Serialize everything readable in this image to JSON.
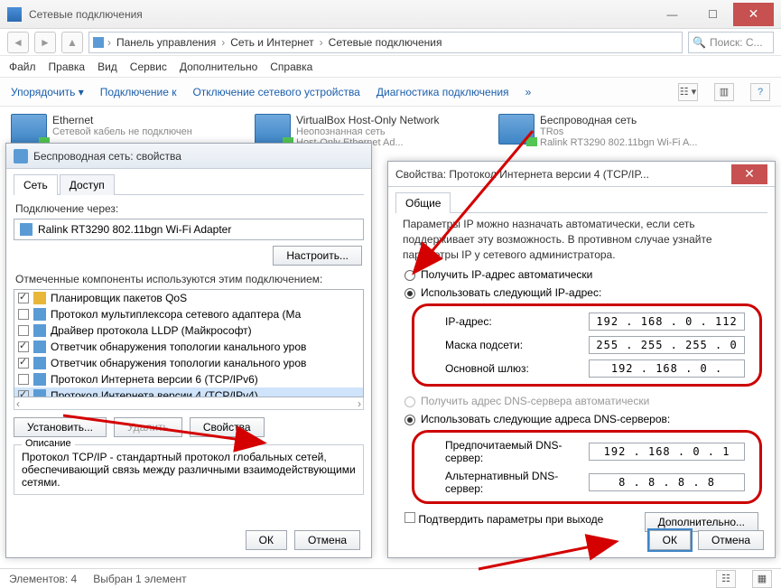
{
  "window": {
    "title": "Сетевые подключения"
  },
  "addr": {
    "seg1": "Панель управления",
    "seg2": "Сеть и Интернет",
    "seg3": "Сетевые подключения",
    "search_ph": "Поиск: С..."
  },
  "menu": {
    "file": "Файл",
    "edit": "Правка",
    "view": "Вид",
    "tools": "Сервис",
    "adv": "Дополнительно",
    "help": "Справка"
  },
  "cmd": {
    "org": "Упорядочить",
    "conn": "Подключение к",
    "disable": "Отключение сетевого устройства",
    "diag": "Диагностика подключения"
  },
  "conns": [
    {
      "name": "Ethernet",
      "l2": "Сетевой кабель не подключен"
    },
    {
      "name": "VirtualBox Host-Only Network",
      "l2": "Неопознанная сеть",
      "l3": "Host-Only Ethernet Ad..."
    },
    {
      "name": "Беспроводная сеть",
      "l2": "TRos",
      "l3": "Ralink RT3290 802.11bgn Wi-Fi A..."
    }
  ],
  "status": {
    "count": "Элементов: 4",
    "sel": "Выбран 1 элемент"
  },
  "dlgL": {
    "title": "Беспроводная сеть: свойства",
    "tab1": "Сеть",
    "tab2": "Доступ",
    "conn_via": "Подключение через:",
    "adapter": "Ralink RT3290 802.11bgn Wi-Fi Adapter",
    "configure": "Настроить...",
    "marked": "Отмеченные компоненты используются этим подключением:",
    "items": [
      {
        "c": true,
        "t": "Планировщик пакетов QoS"
      },
      {
        "c": false,
        "t": "Протокол мультиплексора сетевого адаптера (Ма"
      },
      {
        "c": false,
        "t": "Драйвер протокола LLDP (Майкрософт)"
      },
      {
        "c": true,
        "t": "Ответчик обнаружения топологии канального уров"
      },
      {
        "c": true,
        "t": "Ответчик обнаружения топологии канального уров"
      },
      {
        "c": false,
        "t": "Протокол Интернета версии 6 (TCP/IPv6)"
      },
      {
        "c": true,
        "t": "Протокол Интернета версии 4 (TCP/IPv4)"
      }
    ],
    "install": "Установить...",
    "remove": "Удалить",
    "props": "Свойства",
    "desc_t": "Описание",
    "desc": "Протокол TCP/IP - стандартный протокол глобальных сетей, обеспечивающий связь между различными взаимодействующими сетями.",
    "ok": "ОК",
    "cancel": "Отмена"
  },
  "dlgR": {
    "title": "Свойства: Протокол Интернета версии 4 (TCP/IP...",
    "tab": "Общие",
    "para": "Параметры IP можно назначать автоматически, если сеть поддерживает эту возможность. В противном случае узнайте параметры IP у сетевого администратора.",
    "auto_ip": "Получить IP-адрес автоматически",
    "use_ip": "Использовать следующий IP-адрес:",
    "ip_l": "IP-адрес:",
    "ip_v": "192 . 168 .  0  . 112",
    "mask_l": "Маска подсети:",
    "mask_v": "255 . 255 . 255 .  0",
    "gw_l": "Основной шлюз:",
    "gw_v": "192 . 168 .  0  .   ",
    "auto_dns": "Получить адрес DNS-сервера автоматически",
    "use_dns": "Использовать следующие адреса DNS-серверов:",
    "dns1_l": "Предпочитаемый DNS-сервер:",
    "dns1_v": "192 . 168 .  0  .  1",
    "dns2_l": "Альтернативный DNS-сервер:",
    "dns2_v": "8  .  8  .  8  .  8",
    "validate": "Подтвердить параметры при выходе",
    "adv": "Дополнительно...",
    "ok": "ОК",
    "cancel": "Отмена"
  }
}
